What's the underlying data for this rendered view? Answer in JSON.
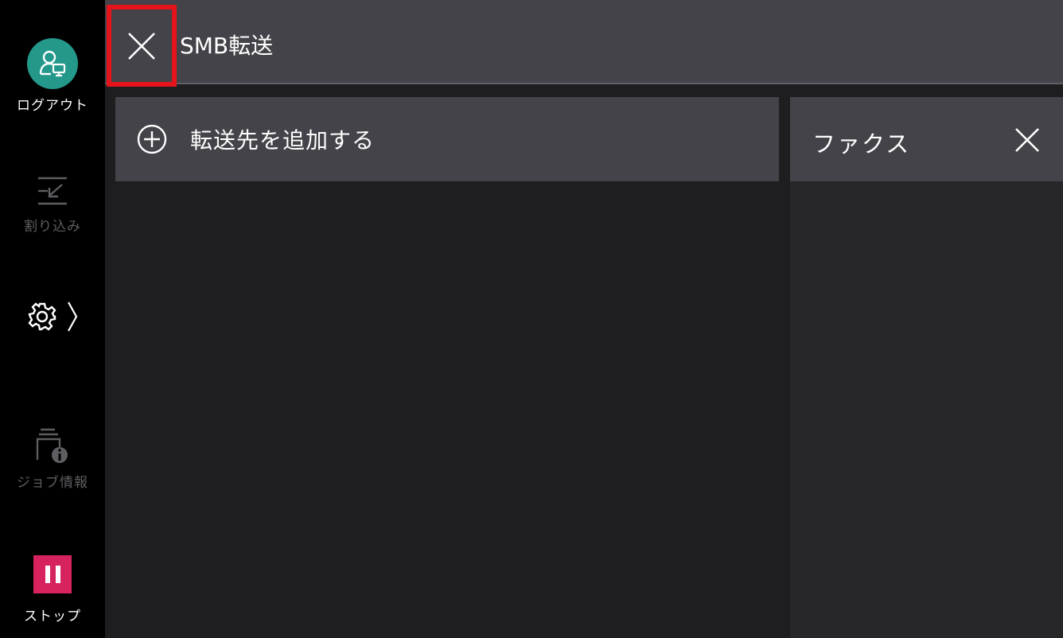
{
  "header": {
    "title": "SMB転送"
  },
  "rail": {
    "logout_label": "ログアウト",
    "interrupt_label": "割り込み",
    "job_info_label": "ジョブ情報",
    "stop_label": "ストップ"
  },
  "main": {
    "add_destination_label": "転送先を追加する"
  },
  "side": {
    "fax_label": "ファクス"
  },
  "colors": {
    "accent_teal": "#24988b",
    "stop_red": "#d6235d",
    "highlight_red": "#e5141a"
  }
}
